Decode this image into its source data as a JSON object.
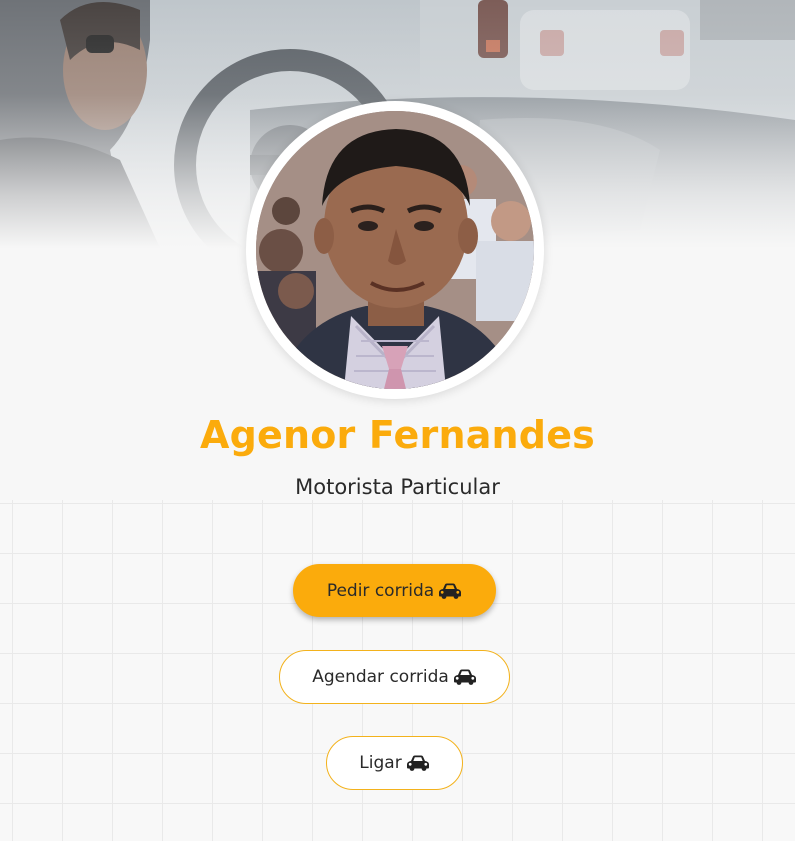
{
  "profile": {
    "name": "Agenor Fernandes",
    "role": "Motorista Particular"
  },
  "actions": [
    {
      "label": "Pedir corrida",
      "icon": "car-icon",
      "style": "primary"
    },
    {
      "label": "Agendar corrida",
      "icon": "car-icon",
      "style": "outline"
    },
    {
      "label": "Ligar",
      "icon": "car-icon",
      "style": "outline"
    }
  ],
  "colors": {
    "accent": "#fbab0c",
    "text": "#2a2a2a",
    "background": "#f7f7f7"
  }
}
